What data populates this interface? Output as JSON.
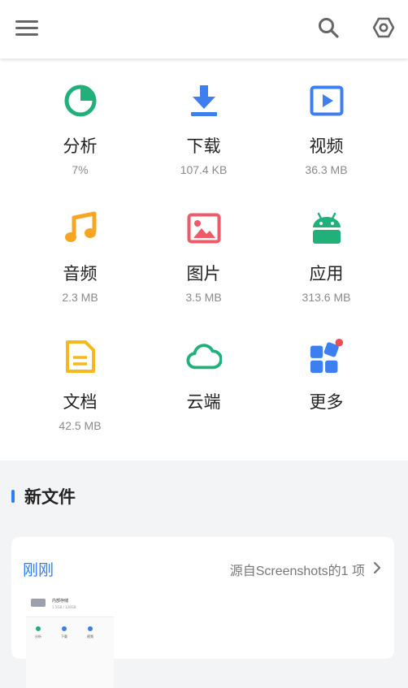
{
  "header": {
    "menu_icon": "hamburger-menu-icon",
    "search_icon": "search-icon",
    "settings_icon": "hexagon-gear-icon"
  },
  "categories": [
    {
      "label": "分析",
      "size": "7%",
      "icon": "pie-chart-icon",
      "color": "#21b07a"
    },
    {
      "label": "下载",
      "size": "107.4 KB",
      "icon": "download-arrow-icon",
      "color": "#3d7ff0"
    },
    {
      "label": "视频",
      "size": "36.3 MB",
      "icon": "video-play-icon",
      "color": "#3d7ff0"
    },
    {
      "label": "音频",
      "size": "2.3 MB",
      "icon": "music-note-icon",
      "color": "#f6a623"
    },
    {
      "label": "图片",
      "size": "3.5 MB",
      "icon": "image-icon",
      "color": "#ee5a67"
    },
    {
      "label": "应用",
      "size": "313.6 MB",
      "icon": "android-icon",
      "color": "#21b07a"
    },
    {
      "label": "文档",
      "size": "42.5 MB",
      "icon": "document-icon",
      "color": "#f6b81d"
    },
    {
      "label": "云端",
      "size": "",
      "icon": "cloud-icon",
      "color": "#21b07a"
    },
    {
      "label": "更多",
      "size": "",
      "icon": "apps-grid-icon",
      "color": "#3d7ff0"
    }
  ],
  "new_files": {
    "title": "新文件",
    "group": {
      "when": "刚刚",
      "source": "源自Screenshots的1 项",
      "thumb": {
        "title": "内部存储",
        "subtitle": "1.5GB / 128GB",
        "items": [
          "分析",
          "下载",
          "视频"
        ]
      }
    }
  }
}
